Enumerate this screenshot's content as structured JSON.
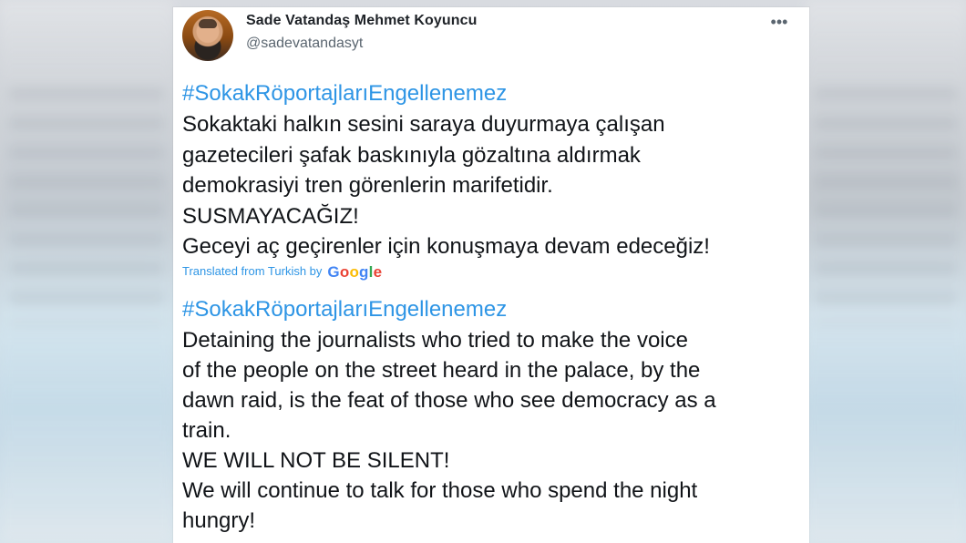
{
  "tweet": {
    "display_name": "Sade Vatandaş Mehmet Koyuncu",
    "handle": "@sadevatandasyt",
    "more_icon": "more-horizontal-icon",
    "hashtag": "#SokakRöportajlarıEngellenemez",
    "original_text": "Sokaktaki halkın sesini saraya duyurmaya çalışan\ngazetecileri şafak baskınıyla gözaltına aldırmak\ndemokrasiyi tren görenlerin marifetidir.\nSUSMAYACAĞIZ!\nGeceyi aç geçirenler için konuşmaya devam edeceğiz!",
    "translated_label": "Translated from Turkish by",
    "translator": {
      "letters": [
        "G",
        "o",
        "o",
        "g",
        "l",
        "e"
      ],
      "colors": [
        "#4285F4",
        "#EA4335",
        "#FBBC05",
        "#4285F4",
        "#34A853",
        "#EA4335"
      ]
    },
    "hashtag_translated": "#SokakRöportajlarıEngellenemez",
    "translated_text": " Detaining the journalists who tried to make the voice\nof the people on the street heard in the palace, by the\ndawn raid, is the feat of those who see democracy as a\ntrain.\n WE WILL NOT BE SILENT!\n We will continue to talk for those who spend the night\nhungry!"
  }
}
